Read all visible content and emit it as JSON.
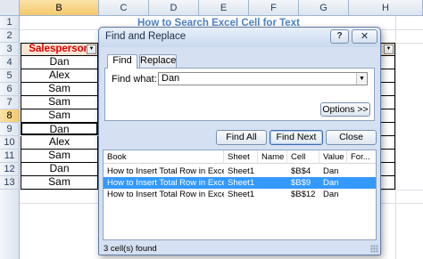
{
  "sheet": {
    "columns": [
      "B",
      "C",
      "D",
      "E",
      "F",
      "G",
      "H"
    ],
    "active_column": "B",
    "rows": [
      "1",
      "2",
      "3",
      "4",
      "5",
      "6",
      "7",
      "8",
      "9",
      "10",
      "11",
      "12",
      "13"
    ],
    "active_row": "9",
    "title": "How to Search Excel Cell for Text",
    "header": "Salesperson",
    "filter_glyph": "▼",
    "values": [
      "Dan",
      "Alex",
      "Sam",
      "Sam",
      "Sam",
      "Dan",
      "Alex",
      "Sam",
      "Dan",
      "Sam"
    ]
  },
  "dialog": {
    "title": "Find and Replace",
    "help_label": "?",
    "close_glyph": "✕",
    "tabs": [
      "Find",
      "Replace"
    ],
    "active_tab": "Find",
    "find_label": "Find what:",
    "find_value": "Dan",
    "dropdown_glyph": "▼",
    "options_label": "Options >>",
    "buttons": {
      "find_all": "Find All",
      "find_next": "Find Next",
      "close": "Close"
    },
    "results": {
      "columns": [
        "Book",
        "Sheet",
        "Name",
        "Cell",
        "Value",
        "For..."
      ],
      "rows": [
        {
          "book": "How to Insert Total Row in Excel.xlsx",
          "sheet": "Sheet1",
          "name": "",
          "cell": "$B$4",
          "value": "Dan",
          "formula": ""
        },
        {
          "book": "How to Insert Total Row in Excel.xlsx",
          "sheet": "Sheet1",
          "name": "",
          "cell": "$B$9",
          "value": "Dan",
          "formula": ""
        },
        {
          "book": "How to Insert Total Row in Excel.xlsx",
          "sheet": "Sheet1",
          "name": "",
          "cell": "$B$12",
          "value": "Dan",
          "formula": ""
        }
      ],
      "selected_index": 1
    },
    "status": "3 cell(s) found"
  },
  "colors": {
    "header_fill": "#fbe4d3",
    "header_text": "#e00000",
    "title_text": "#4d83c6",
    "selection": "#3399ff",
    "dialog_bg": "#d5e1f2"
  }
}
